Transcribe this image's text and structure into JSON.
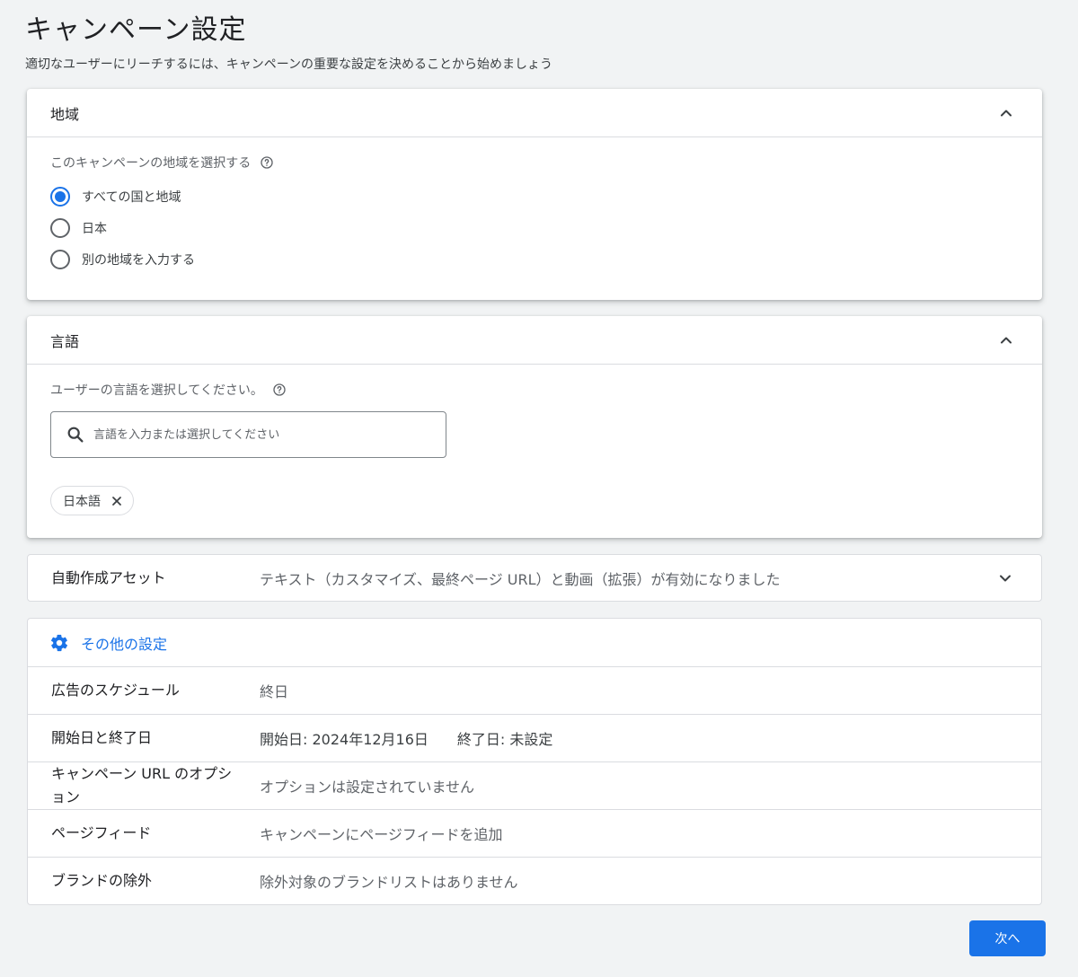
{
  "page": {
    "title": "キャンペーン設定",
    "subtitle": "適切なユーザーにリーチするには、キャンペーンの重要な設定を決めることから始めましょう"
  },
  "location": {
    "title": "地域",
    "question": "このキャンペーンの地域を選択する",
    "options": [
      "すべての国と地域",
      "日本",
      "別の地域を入力する"
    ],
    "selected_index": 0
  },
  "language": {
    "title": "言語",
    "question": "ユーザーの言語を選択してください。",
    "search_placeholder": "言語を入力または選択してください",
    "chips": [
      "日本語"
    ]
  },
  "auto_assets": {
    "label": "自動作成アセット",
    "value": "テキスト（カスタマイズ、最終ページ URL）と動画（拡張）が有効になりました"
  },
  "other_settings": {
    "label": "その他の設定"
  },
  "settings_rows": [
    {
      "label": "広告のスケジュール",
      "value": "終日"
    },
    {
      "label": "開始日と終了日",
      "start": "開始日: 2024年12月16日",
      "end": "終了日: 未設定"
    },
    {
      "label": "キャンペーン URL のオプション",
      "value": "オプションは設定されていません"
    },
    {
      "label": "ページフィード",
      "value": "キャンペーンにページフィードを追加"
    },
    {
      "label": "ブランドの除外",
      "value": "除外対象のブランドリストはありません"
    }
  ],
  "footer": {
    "next_label": "次へ"
  },
  "colors": {
    "accent": "#1a73e8",
    "background": "#f1f3f4"
  },
  "icons": [
    "chevron-up-icon",
    "chevron-down-icon",
    "help-icon",
    "search-icon",
    "close-icon",
    "gear-icon"
  ]
}
